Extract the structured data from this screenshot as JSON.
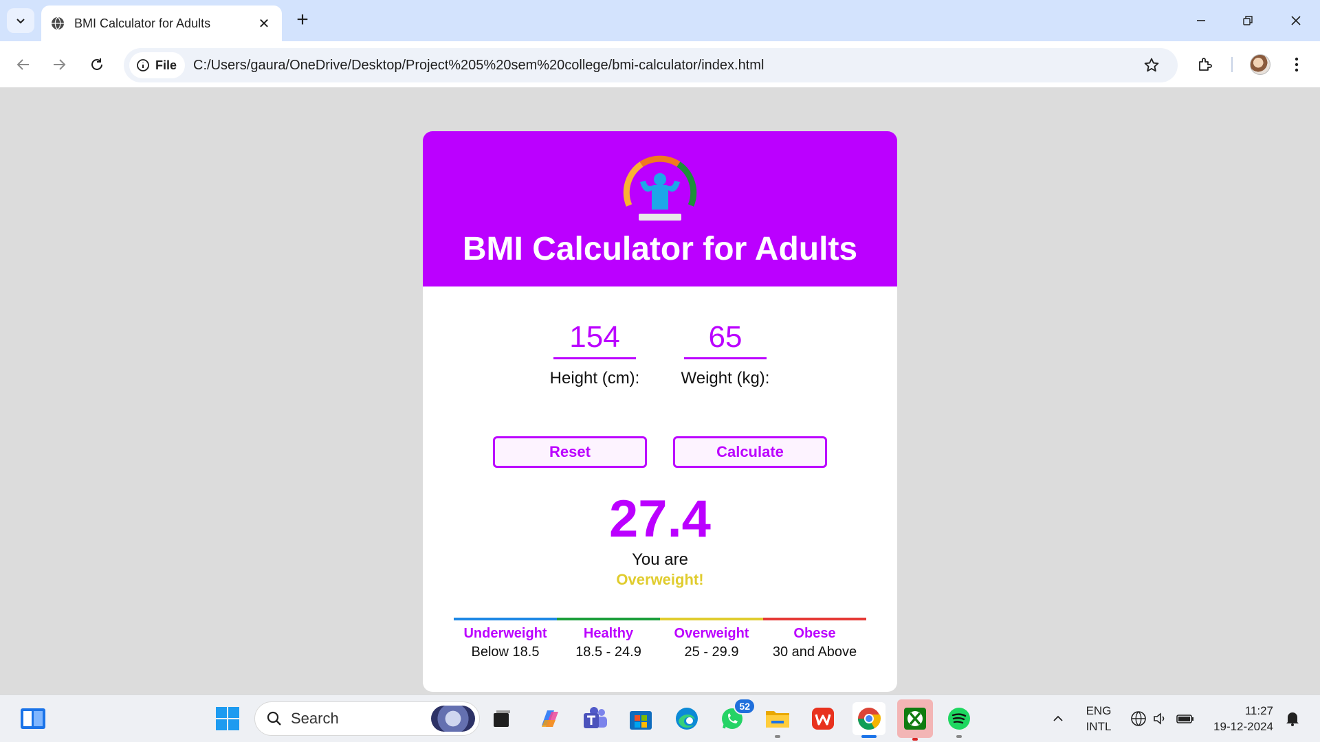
{
  "browser": {
    "tab_title": "BMI Calculator for Adults",
    "site_chip": "File",
    "url": "C:/Users/gaura/OneDrive/Desktop/Project%205%20sem%20college/bmi-calculator/index.html"
  },
  "app": {
    "title": "BMI Calculator for Adults",
    "height_value": "154",
    "height_label": "Height (cm):",
    "weight_value": "65",
    "weight_label": "Weight (kg):",
    "reset_label": "Reset",
    "calculate_label": "Calculate",
    "bmi_result": "27.4",
    "result_prefix": "You are",
    "result_status": "Overweight!",
    "accent_color": "#bb00ff",
    "status_color": "#e0cc2e"
  },
  "scale": [
    {
      "category": "Underweight",
      "range": "Below 18.5",
      "color": "#1e88e5"
    },
    {
      "category": "Healthy",
      "range": "18.5 - 24.9",
      "color": "#1b9e3a"
    },
    {
      "category": "Overweight",
      "range": "25 - 29.9",
      "color": "#e0cc2e"
    },
    {
      "category": "Obese",
      "range": "30 and Above",
      "color": "#e53935"
    }
  ],
  "taskbar": {
    "search_placeholder": "Search",
    "whatsapp_badge": "52",
    "lang_top": "ENG",
    "lang_bottom": "INTL",
    "time": "11:27",
    "date": "19-12-2024"
  }
}
